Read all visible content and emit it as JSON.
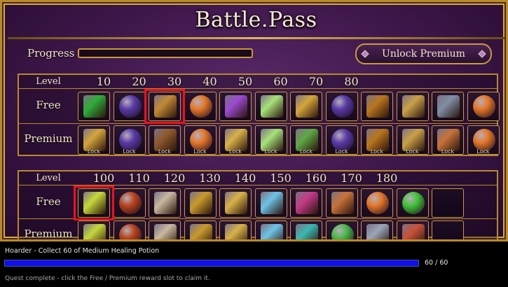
{
  "title": "Battle.Pass",
  "progress": {
    "label": "Progress",
    "fraction": 0.0
  },
  "unlock_button": {
    "label": "Unlock Premium"
  },
  "tier_blocks": [
    {
      "level_label": "Level",
      "levels": [
        "10",
        "20",
        "30",
        "40",
        "50",
        "60",
        "70",
        "80"
      ],
      "free_label": "Free",
      "premium_label": "Premium",
      "free": [
        {
          "icon": "green-scroll-icon",
          "color": "#2fae3a"
        },
        {
          "icon": "purple-orb-icon",
          "color": "#5a3aa8"
        },
        {
          "icon": "gold-chestplate-icon",
          "color": "#c28a36"
        },
        {
          "icon": "orange-egg-icon",
          "color": "#e5772a"
        },
        {
          "icon": "purple-backpack-icon",
          "color": "#9a4ad0"
        },
        {
          "icon": "green-potion-icon",
          "color": "#a8e27a"
        },
        {
          "icon": "gold-scroll-icon",
          "color": "#d4a53c"
        },
        {
          "icon": "purple-orb-icon",
          "color": "#5a3aa8"
        },
        {
          "icon": "treasure-chest-icon",
          "color": "#b9761e"
        },
        {
          "icon": "golden-key-icon",
          "color": "#c9a14a"
        },
        {
          "icon": "steel-chestplate-icon",
          "color": "#7f8ea6"
        },
        {
          "icon": "orange-egg-icon",
          "color": "#e5772a"
        }
      ],
      "premium": [
        {
          "icon": "gold-scroll-icon",
          "color": "#d4a53c",
          "lock": "Lock"
        },
        {
          "icon": "purple-orb-icon",
          "color": "#5a3aa8",
          "lock": "Lock"
        },
        {
          "icon": "bronze-chestplate-icon",
          "color": "#8d5a2e",
          "lock": "Lock"
        },
        {
          "icon": "orange-egg-icon",
          "color": "#e5772a",
          "lock": "Lock"
        },
        {
          "icon": "gold-backpack-icon",
          "color": "#d8b24a",
          "lock": "Lock"
        },
        {
          "icon": "green-potion-icon",
          "color": "#a8e27a",
          "lock": "Lock"
        },
        {
          "icon": "gold-scroll-icon",
          "color": "#5fa846",
          "lock": "Lock"
        },
        {
          "icon": "purple-orb-icon",
          "color": "#5a3aa8",
          "lock": "Lock"
        },
        {
          "icon": "treasure-chest-icon",
          "color": "#b9761e",
          "lock": "Lock"
        },
        {
          "icon": "golden-key-icon",
          "color": "#c9a14a",
          "lock": "Lock"
        },
        {
          "icon": "copper-backpack-icon",
          "color": "#c6733a",
          "lock": "Lock"
        },
        {
          "icon": "orange-egg-icon",
          "color": "#e5772a",
          "lock": "Lock"
        }
      ],
      "highlight_free_index": 2
    },
    {
      "level_label": "Level",
      "levels": [
        "100",
        "110",
        "120",
        "130",
        "140",
        "150",
        "160",
        "170",
        "180"
      ],
      "free_label": "Free",
      "premium_label": "Premium",
      "free": [
        {
          "icon": "gold-scroll-icon",
          "color": "#c6d83c"
        },
        {
          "icon": "dragon-eye-icon",
          "color": "#b8431e"
        },
        {
          "icon": "dragon-skull-icon",
          "color": "#c9b8a0"
        },
        {
          "icon": "gold-chest-icon",
          "color": "#c99a2e"
        },
        {
          "icon": "gold-backpack-icon",
          "color": "#d8b24a"
        },
        {
          "icon": "blue-potion-icon",
          "color": "#6ec3e6"
        },
        {
          "icon": "magenta-rune-icon",
          "color": "#c23a86"
        },
        {
          "icon": "copper-backpack-icon",
          "color": "#c6733a"
        },
        {
          "icon": "orange-egg-icon",
          "color": "#e5772a"
        },
        {
          "icon": "green-apple-icon",
          "color": "#44c23a"
        },
        {
          "icon": "empty-slot",
          "color": ""
        }
      ],
      "premium": [
        {
          "icon": "gold-scroll-icon",
          "color": "#c6d83c"
        },
        {
          "icon": "dragon-eye-icon",
          "color": "#b8431e"
        },
        {
          "icon": "dragon-skull-icon",
          "color": "#c9b8a0"
        },
        {
          "icon": "gold-chest-icon",
          "color": "#c99a2e"
        },
        {
          "icon": "gold-backpack-icon",
          "color": "#d8b24a"
        },
        {
          "icon": "blue-potion-icon",
          "color": "#6ec3e6"
        },
        {
          "icon": "teal-backpack-icon",
          "color": "#3ab8b0"
        },
        {
          "icon": "rainbow-orb-icon",
          "color": "#4ab84a"
        },
        {
          "icon": "steel-chestplate-icon",
          "color": "#9aa6b8"
        },
        {
          "icon": "jeweled-necklace-icon",
          "color": "#c8523a"
        },
        {
          "icon": "empty-slot",
          "color": ""
        }
      ],
      "highlight_free_index": 0
    }
  ],
  "quest": {
    "title": "Hoarder -  Collect 60 of Medium Healing Potion",
    "current": 60,
    "target": 60,
    "count_text": "60 / 60",
    "note": "Quest complete - click the Free / Premium reward slot to claim it."
  }
}
